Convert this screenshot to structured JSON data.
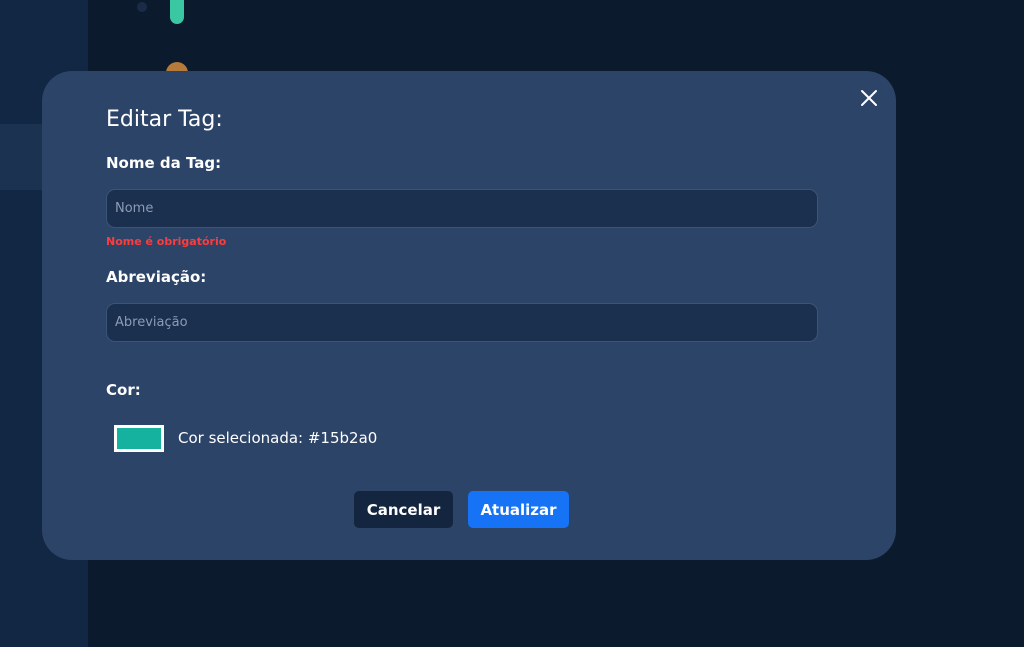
{
  "modal": {
    "title": "Editar Tag:",
    "name_label": "Nome da Tag:",
    "name_placeholder": "Nome",
    "name_value": "",
    "name_error": "Nome é obrigatório",
    "abbr_label": "Abreviação:",
    "abbr_placeholder": "Abreviação",
    "abbr_value": "",
    "color_label": "Cor:",
    "selected_color_text": "Cor selecionada: #15b2a0",
    "selected_color": "#15b2a0",
    "cancel_label": "Cancelar",
    "update_label": "Atualizar"
  },
  "colors": {
    "overlay_bg": "#0c1a2e",
    "modal_bg": "#2c4468",
    "input_bg": "#1b2f4f",
    "error": "#ff3b3b",
    "primary": "#1673f5",
    "cancel_bg": "#13253f"
  },
  "icons": {
    "close": "close-icon"
  }
}
